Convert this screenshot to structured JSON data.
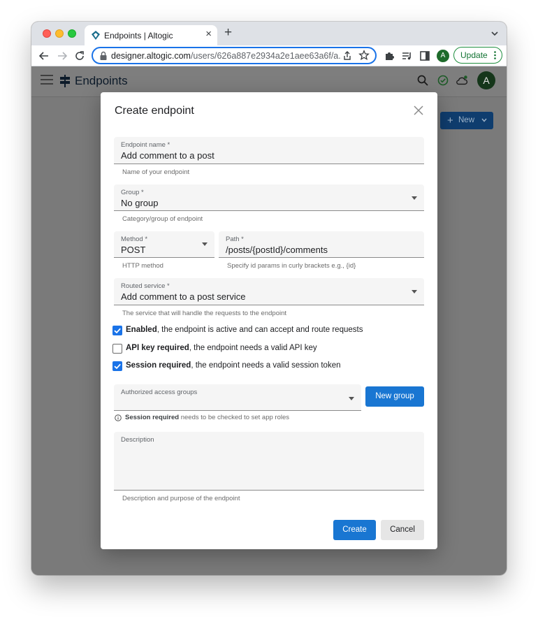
{
  "browser": {
    "tab_title": "Endpoints | Altogic",
    "tab_close": "×",
    "new_tab": "+",
    "url_host": "designer.altogic.com",
    "url_path": "/users/626a887e2934a2e1aee63a6f/a...",
    "profile_initial": "A",
    "update_label": "Update"
  },
  "app": {
    "title": "Endpoints",
    "avatar_initial": "A",
    "new_button_plus": "+",
    "new_button_label": "New"
  },
  "dialog": {
    "title": "Create endpoint",
    "endpoint_name": {
      "label": "Endpoint name *",
      "value": "Add comment to a post",
      "helper": "Name of your endpoint"
    },
    "group": {
      "label": "Group *",
      "value": "No group",
      "helper": "Category/group of endpoint"
    },
    "method": {
      "label": "Method *",
      "value": "POST",
      "helper": "HTTP method"
    },
    "path": {
      "label": "Path *",
      "value": "/posts/{postId}/comments",
      "helper": "Specify id params in curly brackets e.g., {id}"
    },
    "routed_service": {
      "label": "Routed service *",
      "value": "Add comment to a post service",
      "helper": "The service that will handle the requests to the endpoint"
    },
    "checks": [
      {
        "bold": "Enabled",
        "text": ", the endpoint is active and can accept and route requests",
        "checked": true
      },
      {
        "bold": "API key required",
        "text": ", the endpoint needs a valid API key",
        "checked": false
      },
      {
        "bold": "Session required",
        "text": ", the endpoint needs a valid session token",
        "checked": true
      }
    ],
    "access_groups": {
      "label": "Authorized access groups",
      "value": ""
    },
    "new_group_label": "New group",
    "info": {
      "bold": "Session required",
      "text": " needs to be checked to set app roles"
    },
    "description": {
      "label": "Description",
      "value": "",
      "helper": "Description and purpose of the endpoint"
    },
    "create_label": "Create",
    "cancel_label": "Cancel"
  },
  "colors": {
    "accent": "#1976d2",
    "checkbox": "#1a73e8",
    "update_green": "#137333"
  }
}
